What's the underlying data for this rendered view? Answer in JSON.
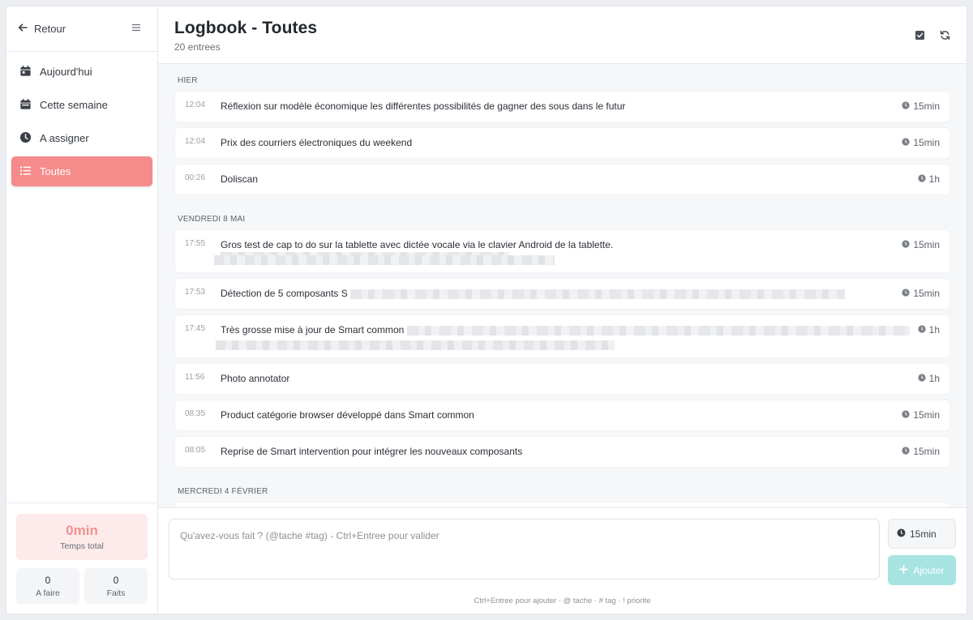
{
  "sidebar": {
    "back_label": "Retour",
    "nav": [
      {
        "label": "Aujourd'hui",
        "icon": "calendar-day-icon"
      },
      {
        "label": "Cette semaine",
        "icon": "calendar-week-icon"
      },
      {
        "label": "A assigner",
        "icon": "clock-icon"
      },
      {
        "label": "Toutes",
        "icon": "list-icon",
        "active": true
      }
    ],
    "total": {
      "value": "0min",
      "label": "Temps total"
    },
    "counts": [
      {
        "value": "0",
        "label": "A faire"
      },
      {
        "value": "0",
        "label": "Faits"
      }
    ]
  },
  "header": {
    "title": "Logbook - Toutes",
    "subtitle": "20 entrees"
  },
  "groups": [
    {
      "label": "HIER",
      "entries": [
        {
          "time": "12:04",
          "text": "Réflexion sur modèle économique les différentes possibilités de gagner des sous dans le futur",
          "duration": "15min"
        },
        {
          "time": "12:04",
          "text": "Prix des courriers électroniques du weekend",
          "duration": "15min"
        },
        {
          "time": "00:26",
          "text": "Doliscan",
          "duration": "1h"
        }
      ]
    },
    {
      "label": "VENDREDI 8 MAI",
      "entries": [
        {
          "time": "17:55",
          "text": "Gros test de cap to do sur la tablette avec dictée vocale via le clavier Android de la tablette.",
          "duration": "15min"
        },
        {
          "time": "17:53",
          "text": "Détection de 5 composants S",
          "duration": "15min"
        },
        {
          "time": "17:45",
          "text": "Très grosse mise à jour de Smart common",
          "duration": "1h"
        },
        {
          "time": "11:56",
          "text": "Photo annotator",
          "duration": "1h"
        },
        {
          "time": "08:35",
          "text": "Product catégorie browser développé dans Smart common",
          "duration": "15min"
        },
        {
          "time": "08:05",
          "text": "Reprise de Smart intervention pour intégrer les nouveaux composants",
          "duration": "15min"
        }
      ]
    },
    {
      "label": "MERCREDI 4 FÉVRIER",
      "entries": []
    }
  ],
  "composer": {
    "placeholder": "Qu'avez-vous fait ? (@tache #tag) - Ctrl+Entree pour valider",
    "duration": "15min",
    "add_label": "Ajouter",
    "hint": "Ctrl+Entree pour ajouter · @ tache · # tag · ! priorite"
  },
  "colors": {
    "accent": "#f58b8b",
    "accent_soft": "#fdeaea",
    "add_button": "#a7e3e1"
  }
}
